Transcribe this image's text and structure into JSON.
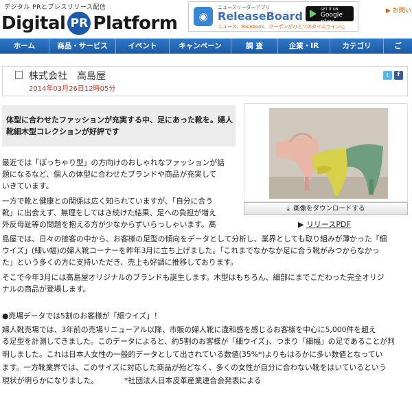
{
  "header": {
    "tagline": "デジタル PRとプレスリリース配信",
    "logo_left": "Digital",
    "logo_mid": "PR",
    "logo_right": "Platform",
    "inquiry": "▶ お問い"
  },
  "banner": {
    "subtitle": "ニュースリーダーアプリ",
    "title": "ReleaseBoard",
    "description": "ニュース、Facebook、クーポンがひとつのタイムラインに",
    "store_top": "GET IT ON",
    "store_name": "Google play"
  },
  "nav": {
    "items": [
      "ホーム",
      "商品・サービス",
      "イベント",
      "キャンペーン",
      "調 査",
      "企業・IR",
      "カテゴリ",
      "ご"
    ]
  },
  "release": {
    "company": "株式会社　高島屋",
    "date": "2014年03月26日12時05分",
    "twitter": "t",
    "facebook": "f",
    "headline": "体型に合わせたファッションが充実する中、足にあった靴を。婦人靴細木型コレクションが好評です"
  },
  "media": {
    "download_label": "画像をダウンロードする",
    "pdf_label": "リリースPDF"
  },
  "body": {
    "lines": [
      "最近では「ぽっちゃり型」の方向けのおしゃれなファッションが話",
      "題になるなど、個人の体型に合わせたブランドや商品が充実して",
      "いきています。",
      "一方で靴と健康との関係は広く知られていますが、「自分に合う",
      "靴」に出会えず、無理をしてはき続けた結果、足への負担が増え",
      "外反母趾等の問題を抱える方が少なからずいらっしゃいます。高",
      "島屋では、日々の接客の中から、お客様の足型の傾向をデータとして分析し、業界としても取り組みが薄かった「細",
      "ウイズ」(細い幅)の婦人靴コーナーを昨年3月に立ち上げました。「これまでなかなか足に合う靴がみつからなかっ",
      "た」という多くの方に支持いただき、売上も好調に推移しております。",
      "そこで今年3月には高島屋オリジナルのブランドも誕生します。木型はもちろん、細部にまでこだわった完全オリジ",
      "ナルの商品が登場します。",
      "",
      "●売場データでは5割のお客様が「細ウイズ」！",
      "婦人靴売場では、3年前の売場リニューアル以降、市販の婦人靴に違和感を感じるお客様を中心に5,000件を超え",
      "る足型を計測してきました。このデータによると、約5割のお客様が「細ウイズ」、つまり「細幅」の足であることが判",
      "明しました。これは日本人女性の一般的データとして出されている数値(35%*)よりもはるかに多い数値となってい",
      "ます。一方靴業界では、このサイズに対応した商品が殆どなく、多くの女性が自分に合わない靴をはいているという",
      "現状が明らかになりました。　　　　*社団法人日本皮革産業連合会発表による"
    ]
  },
  "colors": {
    "nav_bg": "#1a5aa6",
    "date": "#c0392b",
    "brand_blue": "#1d5aa8",
    "inquiry": "#d06000"
  }
}
